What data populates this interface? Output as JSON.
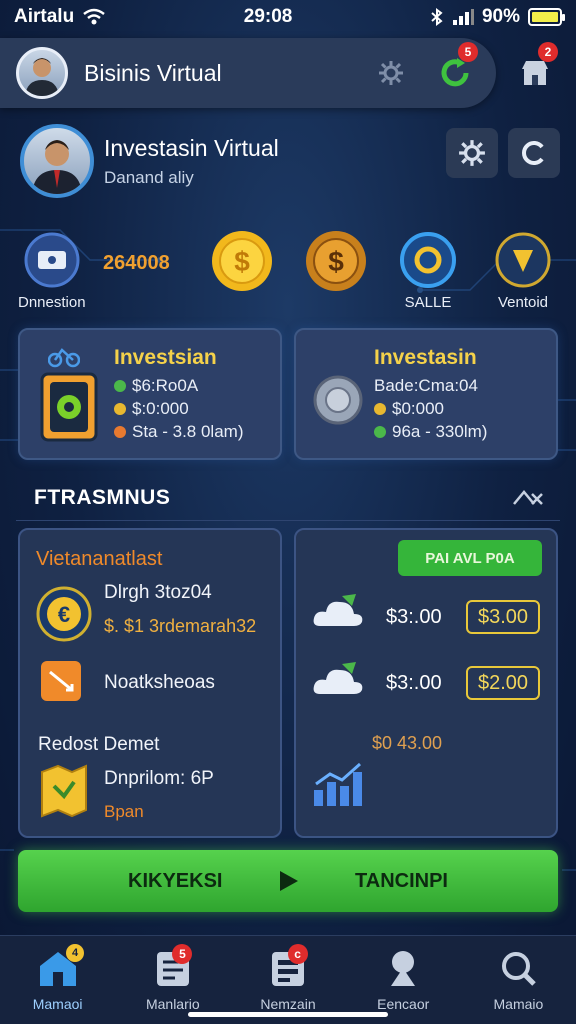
{
  "status_bar": {
    "carrier": "Airtalu",
    "time": "29:08",
    "battery": "90%"
  },
  "header": {
    "title": "Bisinis Virtual",
    "badge_left": "5",
    "badge_right": "2"
  },
  "profile": {
    "name": "Investasin Virtual",
    "subtitle": "Danand aliy"
  },
  "coin_row": {
    "value": "264008",
    "items": [
      {
        "label": "Dnnestion",
        "icon": "ticket-icon"
      },
      {
        "label": "",
        "icon": "dollar-coin-icon"
      },
      {
        "label": "",
        "icon": "bronze-dollar-coin-icon"
      },
      {
        "label": "SALLE",
        "icon": "blue-ring-coin-icon"
      },
      {
        "label": "Ventoid",
        "icon": "shield-coin-icon"
      }
    ]
  },
  "cards": [
    {
      "title": "Investsian",
      "lines": [
        "$6:Ro0A",
        "$:0:000",
        "Sta - 3.8 0lam)"
      ],
      "dot_colors": [
        "#4bb84a",
        "#e8b830",
        "#e87a30"
      ]
    },
    {
      "title": "Investasin",
      "lines": [
        "Bade:Cma:04",
        "$0:000",
        "96a - 330lm)"
      ],
      "dot_colors": [
        "#d0d0d0",
        "#e8b830",
        "#4bb84a"
      ]
    }
  ],
  "section": {
    "title": "FTRASMNUS"
  },
  "left_panel": {
    "title": "Vietananatlast",
    "row1_title": "Dlrgh 3toz04",
    "row1_sub": "$. $1 3rdemarah32",
    "row2": "Noatksheoas",
    "row3_title": "Redost Demet",
    "row4_title": "Dnprilom: 6P",
    "row4_sub": "Bpan"
  },
  "right_panel": {
    "pill": "PAI AVL P0A",
    "price1": "$3:.00",
    "box1": "$3.00",
    "price2": "$3:.00",
    "box2": "$2.00",
    "muted": "$0 43.00"
  },
  "cta": {
    "left": "KIKYEKSI",
    "right": "TANCINPI"
  },
  "bottom_nav": [
    {
      "label": "Mamaoi",
      "badge": "4",
      "icon": "home-icon"
    },
    {
      "label": "Manlario",
      "badge": "5",
      "icon": "document-icon"
    },
    {
      "label": "Nemzain",
      "badge": "c",
      "icon": "list-icon"
    },
    {
      "label": "Eencaor",
      "badge": "",
      "icon": "tree-icon"
    },
    {
      "label": "Mamaio",
      "badge": "",
      "icon": "search-icon"
    }
  ],
  "colors": {
    "accent_green": "#35b53a",
    "gold": "#f5d24a",
    "orange": "#f08a2a",
    "background": "#0f2142"
  }
}
